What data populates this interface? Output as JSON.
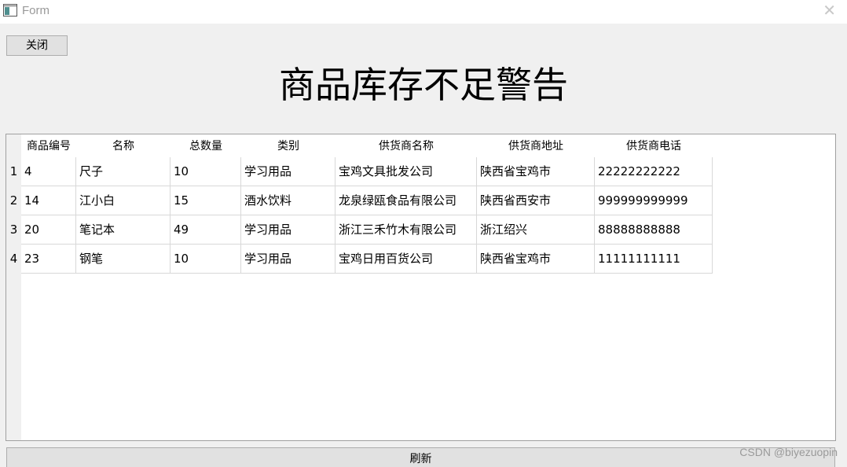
{
  "window": {
    "title": "Form",
    "close_glyph": "✕"
  },
  "buttons": {
    "close_label": "关闭",
    "refresh_label": "刷新"
  },
  "heading": "商品库存不足警告",
  "table": {
    "columns": [
      "商品编号",
      "名称",
      "总数量",
      "类别",
      "供货商名称",
      "供货商地址",
      "供货商电话"
    ],
    "row_numbers": [
      "1",
      "2",
      "3",
      "4"
    ],
    "rows": [
      [
        "4",
        "尺子",
        "10",
        "学习用品",
        "宝鸡文具批发公司",
        "陕西省宝鸡市",
        "22222222222"
      ],
      [
        "14",
        "江小白",
        "15",
        "酒水饮料",
        "龙泉绿瓯食品有限公司",
        "陕西省西安市",
        "999999999999"
      ],
      [
        "20",
        "笔记本",
        "49",
        "学习用品",
        "浙江三禾竹木有限公司",
        "浙江绍兴",
        "88888888888"
      ],
      [
        "23",
        "钢笔",
        "10",
        "学习用品",
        "宝鸡日用百货公司",
        "陕西省宝鸡市",
        "11111111111"
      ]
    ]
  },
  "watermark": "CSDN @biyezuopin",
  "colors": {
    "window_bg": "#f0f0f0",
    "button_bg": "#e1e1e1",
    "grid_line": "#d8d8d8"
  }
}
